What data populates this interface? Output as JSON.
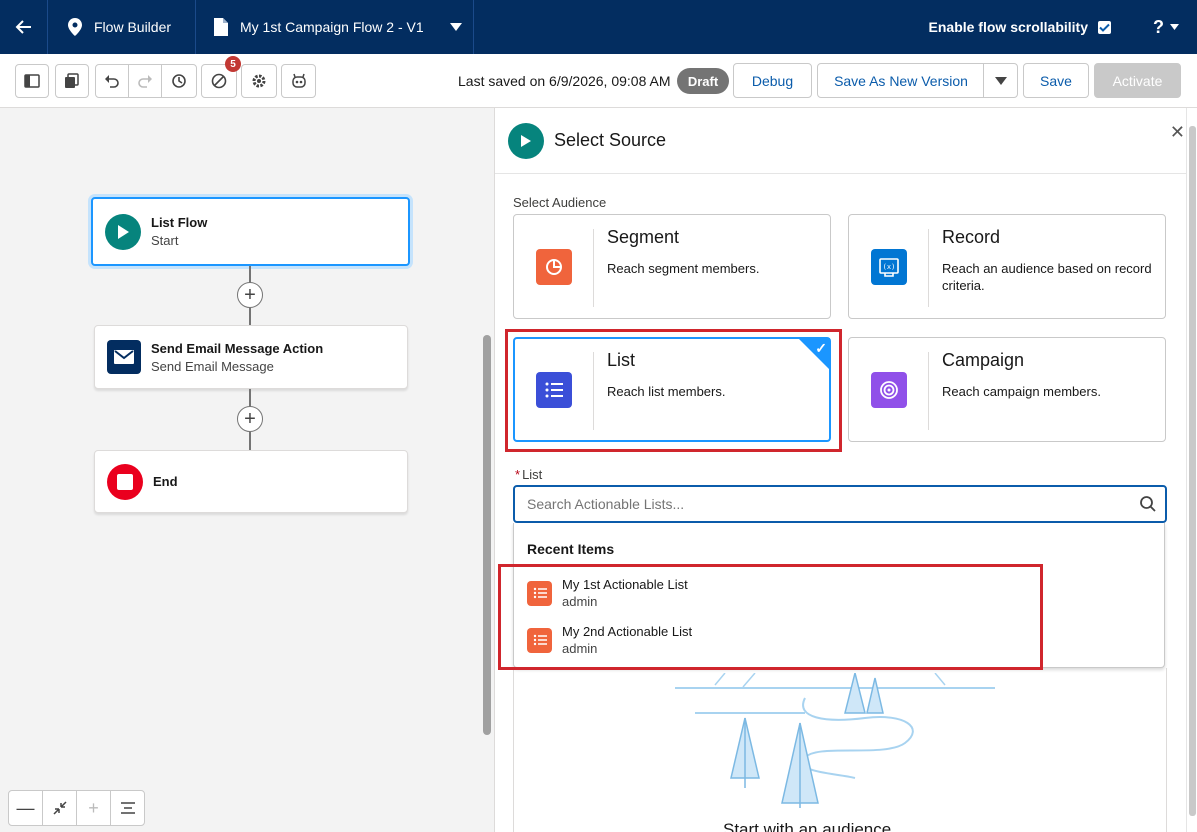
{
  "topbar": {
    "app_name": "Flow Builder",
    "flow_name": "My 1st Campaign Flow 2 - V1",
    "scrollability_label": "Enable flow scrollability",
    "help_label": "?"
  },
  "toolbar": {
    "last_saved": "Last saved on 6/9/2026, 09:08 AM",
    "status": "Draft",
    "error_count": "5",
    "debug_label": "Debug",
    "save_as_label": "Save As New Version",
    "save_label": "Save",
    "activate_label": "Activate"
  },
  "canvas": {
    "nodes": [
      {
        "title": "List Flow",
        "subtitle": "Start"
      },
      {
        "title": "Send Email Message Action",
        "subtitle": "Send Email Message"
      },
      {
        "title": "End",
        "subtitle": ""
      }
    ]
  },
  "panel": {
    "title": "Select Source",
    "section_label": "Select Audience",
    "cards": [
      {
        "title": "Segment",
        "desc": "Reach segment members."
      },
      {
        "title": "Record",
        "desc": "Reach an audience based on record criteria."
      },
      {
        "title": "List",
        "desc": "Reach list members."
      },
      {
        "title": "Campaign",
        "desc": "Reach campaign members."
      }
    ],
    "list_field": {
      "required_mark": "*",
      "label": "List",
      "placeholder": "Search Actionable Lists...",
      "value": ""
    },
    "recent": {
      "heading": "Recent Items",
      "items": [
        {
          "name": "My 1st Actionable List",
          "owner": "admin"
        },
        {
          "name": "My 2nd Actionable List",
          "owner": "admin"
        }
      ]
    },
    "partial_text": "Start with an audience"
  },
  "colors": {
    "nav": "#032d60",
    "brand_blue": "#0b5cab",
    "selection_blue": "#1b96ff",
    "highlight_red": "#d0262d",
    "start_green": "#06847d",
    "segment_orange": "#f0643c",
    "record_teal": "#0176d3",
    "list_indigo": "#3b4fd8",
    "campaign_purple": "#9050e9"
  }
}
